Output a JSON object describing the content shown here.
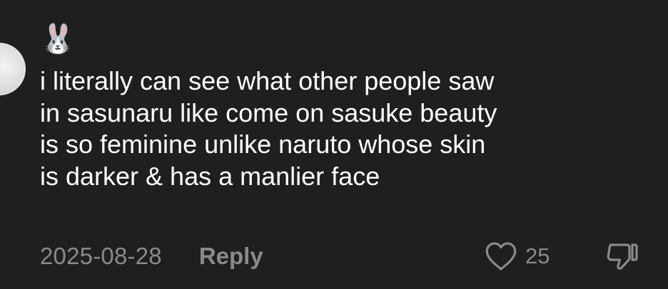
{
  "comment": {
    "username": "🐰",
    "text": "i literally can see what other people saw\nin sasunaru like come on sasuke beauty\nis so feminine unlike naruto whose skin\nis darker & has a manlier face",
    "date": "2025-08-28",
    "reply_label": "Reply",
    "like_count": "25"
  },
  "icons": {
    "like": "heart-icon",
    "dislike": "thumbs-down-icon"
  },
  "colors": {
    "background": "#1f1f1f",
    "text": "#ffffff",
    "muted": "#8a8a8a"
  }
}
